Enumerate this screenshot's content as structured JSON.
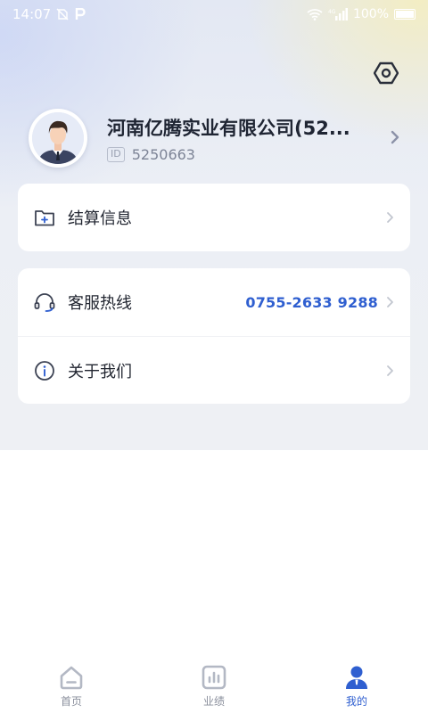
{
  "status_bar": {
    "time": "14:07",
    "left_icons": [
      "no-sim-icon",
      "parking-icon"
    ],
    "right_icons": [
      "wifi-icon",
      "signal-4g-icon",
      "battery-icon"
    ],
    "battery": "100%"
  },
  "header": {
    "settings_icon": "settings-hex-icon"
  },
  "profile": {
    "avatar_icon": "businessman-avatar",
    "company_name": "河南亿腾实业有限公司(52...",
    "id_badge": "ID",
    "id_value": "5250663"
  },
  "menu": {
    "settlement": {
      "icon": "folder-plus-icon",
      "label": "结算信息"
    },
    "hotline": {
      "icon": "headset-icon",
      "label": "客服热线",
      "value": "0755-2633 9288"
    },
    "about": {
      "icon": "info-icon",
      "label": "关于我们"
    }
  },
  "tabbar": {
    "tabs": [
      {
        "label": "首页",
        "icon": "home-icon",
        "active": false
      },
      {
        "label": "业绩",
        "icon": "chart-icon",
        "active": false
      },
      {
        "label": "我的",
        "icon": "user-icon",
        "active": true
      }
    ]
  },
  "colors": {
    "accent": "#2f5fd0",
    "inactive_icon": "#b3b8c4",
    "card_bg": "#ffffff"
  }
}
